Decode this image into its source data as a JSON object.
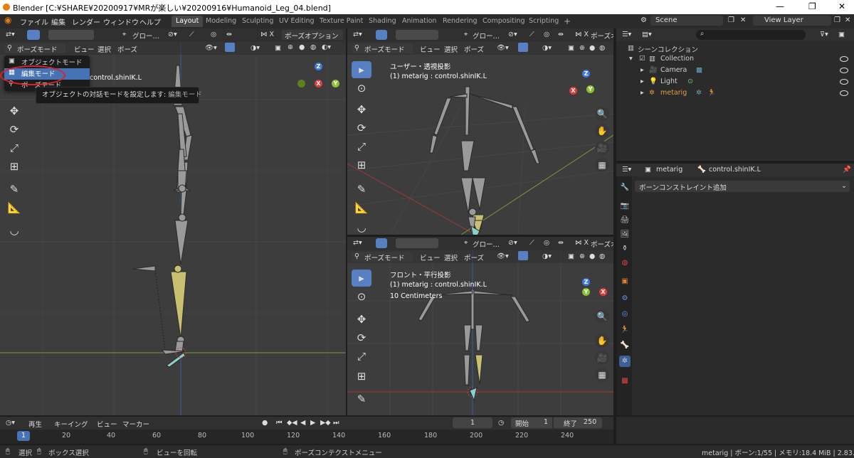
{
  "window": {
    "title": "Blender [C:¥SHARE¥20200917¥MRが楽しい¥20200916¥Humanoid_Leg_04.blend]",
    "min": "—",
    "max": "❐",
    "close": "✕"
  },
  "menu": {
    "items": [
      "ファイル",
      "編集",
      "レンダー",
      "ウィンドウ",
      "ヘルプ"
    ],
    "workspaces": [
      "Layout",
      "Modeling",
      "Sculpting",
      "UV Editing",
      "Texture Paint",
      "Shading",
      "Animation",
      "Rendering",
      "Compositing",
      "Scripting"
    ],
    "active_workspace": "Layout",
    "add": "+",
    "scene": "Scene",
    "view_layer": "View Layer"
  },
  "left_viewport": {
    "header": {
      "transform": "グロー…",
      "pose_options": "ポーズオプション",
      "mode": "ポーズモード",
      "menus": [
        "ビュー",
        "選択",
        "ポーズ"
      ]
    },
    "overlay_text": "control.shinIK.L",
    "mode_menu": {
      "items": [
        "オブジェクトモード",
        "編集モード",
        "ポーズモード"
      ],
      "highlighted": "編集モード"
    },
    "tooltip": {
      "text": "オブジェクトの対話モードを設定します:",
      "mode": "編集モード"
    }
  },
  "right_top_viewport": {
    "header": {
      "mode": "ポーズモード",
      "menus": [
        "ビュー",
        "選択",
        "ポーズ"
      ],
      "transform": "グロー…",
      "pose_options": "ポーズオ"
    },
    "view_name": "ユーザー・透視投影",
    "object_info": "(1) metarig : control.shinIK.L"
  },
  "right_bottom_viewport": {
    "header": {
      "mode": "ポーズモード",
      "menus": [
        "ビュー",
        "選択",
        "ポーズ"
      ],
      "transform": "グロー…",
      "pose_options": "ポーズオ"
    },
    "view_name": "フロント・平行投影",
    "object_info": "(1) metarig : control.shinIK.L",
    "scale": "10 Centimeters"
  },
  "axes": {
    "z": "Z",
    "x": "X",
    "y": "Y"
  },
  "outliner": {
    "search_placeholder": "",
    "scene_collection": "シーンコレクション",
    "rows": [
      "Collection",
      "Camera",
      "Light",
      "metarig"
    ]
  },
  "properties": {
    "object": "metarig",
    "bone": "control.shinIK.L",
    "add_constraint": "ボーンコンストレイント追加"
  },
  "timeline": {
    "menus": [
      "再生",
      "キーイング",
      "ビュー",
      "マーカー"
    ],
    "current_frame": "1",
    "start_label": "開始",
    "start": "1",
    "end_label": "終了",
    "end": "250",
    "ticks": [
      "1",
      "20",
      "40",
      "60",
      "80",
      "100",
      "120",
      "140",
      "160",
      "180",
      "200",
      "220",
      "240"
    ]
  },
  "status": {
    "select": "選択",
    "box_select": "ボックス選択",
    "rotate_view": "ビューを回転",
    "context_menu": "ポーズコンテクストメニュー",
    "info": "metarig | ボーン:1/55 | メモリ:18.4 MiB | 2.83.3"
  }
}
